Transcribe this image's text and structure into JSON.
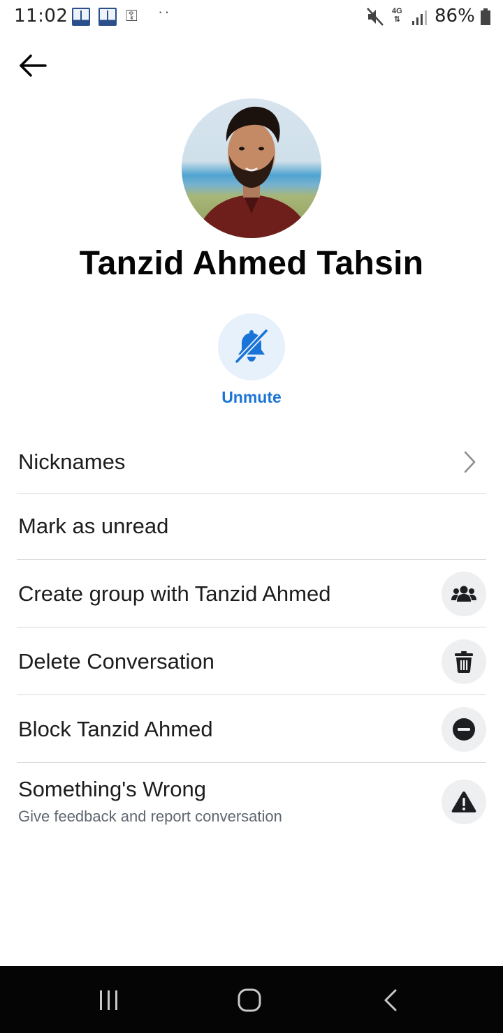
{
  "status_bar": {
    "time": "11:02",
    "network": "4G",
    "battery": "86%"
  },
  "icons": {
    "back": "arrow-left-icon",
    "unmute": "bell-slash-icon",
    "nicknames": "chevron-right-icon",
    "create_group": "people-icon",
    "delete": "trash-icon",
    "block": "minus-circle-icon",
    "report": "warning-triangle-icon"
  },
  "profile": {
    "name": "Tanzid Ahmed Tahsin"
  },
  "actions": {
    "unmute_label": "Unmute"
  },
  "menu": {
    "items": [
      {
        "label": "Nicknames"
      },
      {
        "label": "Mark as unread"
      },
      {
        "label": "Create group with Tanzid Ahmed"
      },
      {
        "label": "Delete Conversation"
      },
      {
        "label": "Block Tanzid Ahmed"
      },
      {
        "label": "Something's Wrong",
        "sublabel": "Give feedback and report conversation"
      }
    ]
  },
  "colors": {
    "accent": "#1a74d8",
    "accent_bg": "#e7f1fc",
    "text": "#050505",
    "subtext": "#606770",
    "divider": "#d9d9d9",
    "icon_bg": "#eeeff1",
    "nav_bar": "#050505"
  }
}
